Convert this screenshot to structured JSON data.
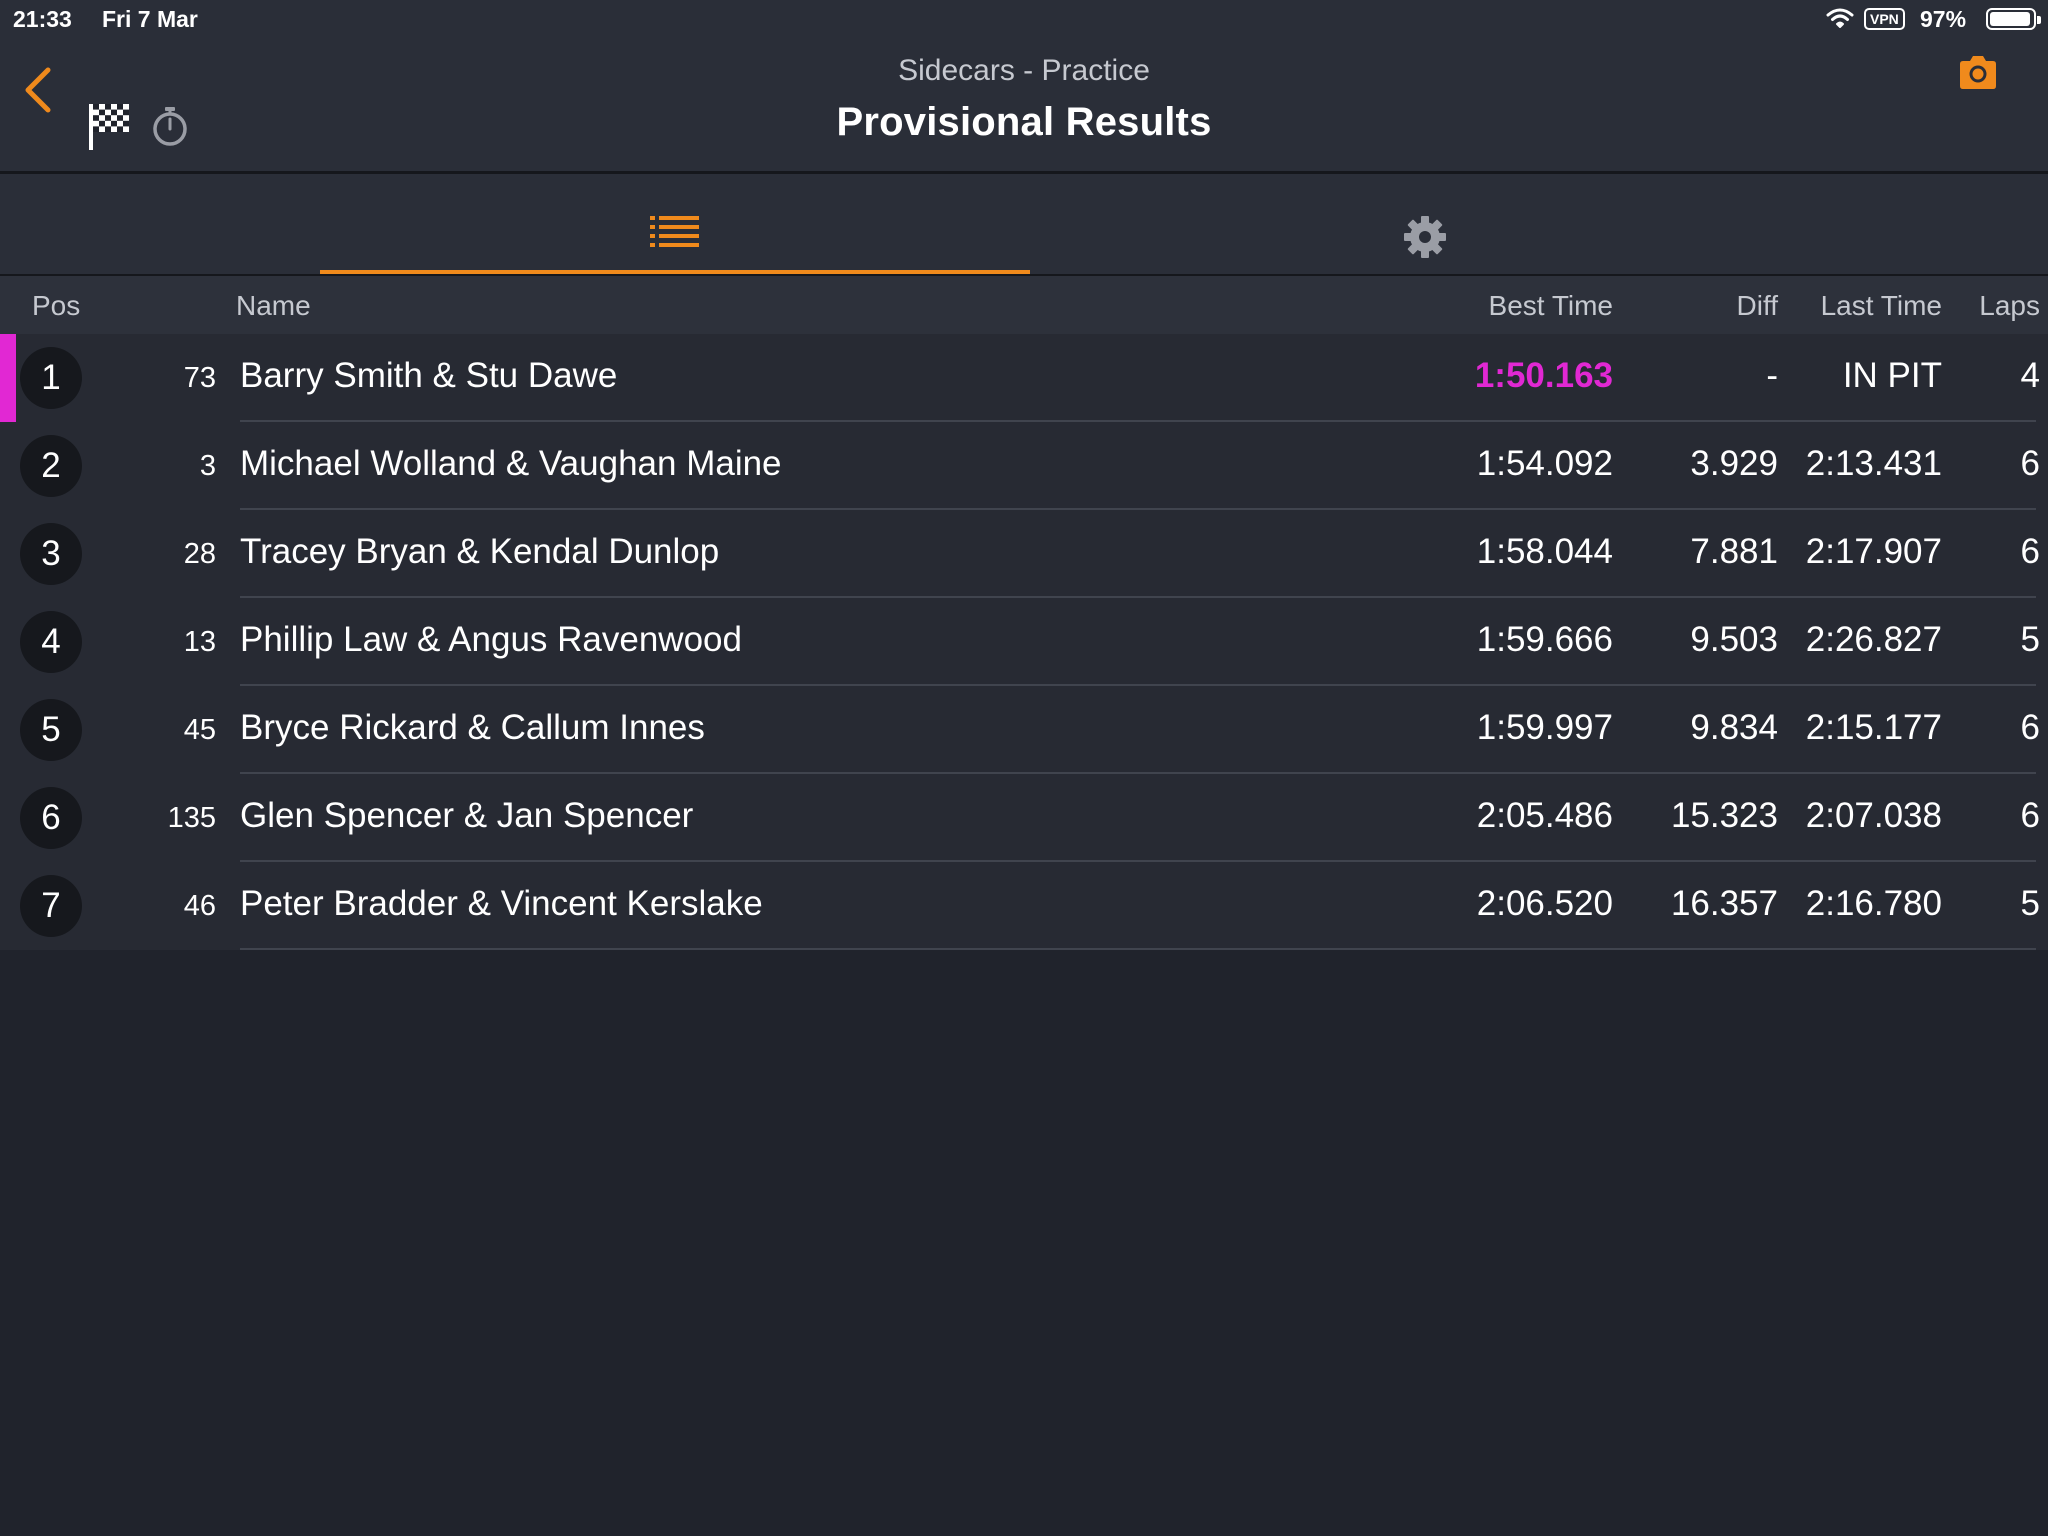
{
  "status_bar": {
    "time": "21:33",
    "date": "Fri 7 Mar",
    "vpn": "VPN",
    "battery": "97%",
    "battery_level": 0.97
  },
  "header": {
    "subtitle": "Sidecars - Practice",
    "title": "Provisional Results",
    "back_icon": "chevron-left-icon",
    "flag_icon": "checkered-flag-icon",
    "stopwatch_icon": "stopwatch-icon",
    "camera_icon": "camera-icon"
  },
  "tabs": [
    {
      "icon": "list-icon",
      "active": true
    },
    {
      "icon": "gear-icon",
      "active": false
    }
  ],
  "columns": {
    "pos": "Pos",
    "name": "Name",
    "best": "Best Time",
    "diff": "Diff",
    "last": "Last Time",
    "laps": "Laps"
  },
  "rows": [
    {
      "pos": "1",
      "num": "73",
      "name": "Barry Smith & Stu Dawe",
      "best": "1:50.163",
      "diff": "-",
      "last": "IN PIT",
      "laps": "4",
      "fastest": true
    },
    {
      "pos": "2",
      "num": "3",
      "name": "Michael Wolland & Vaughan Maine",
      "best": "1:54.092",
      "diff": "3.929",
      "last": "2:13.431",
      "laps": "6"
    },
    {
      "pos": "3",
      "num": "28",
      "name": "Tracey Bryan & Kendal Dunlop",
      "best": "1:58.044",
      "diff": "7.881",
      "last": "2:17.907",
      "laps": "6"
    },
    {
      "pos": "4",
      "num": "13",
      "name": "Phillip Law & Angus Ravenwood",
      "best": "1:59.666",
      "diff": "9.503",
      "last": "2:26.827",
      "laps": "5"
    },
    {
      "pos": "5",
      "num": "45",
      "name": "Bryce Rickard & Callum Innes",
      "best": "1:59.997",
      "diff": "9.834",
      "last": "2:15.177",
      "laps": "6"
    },
    {
      "pos": "6",
      "num": "135",
      "name": "Glen Spencer & Jan Spencer",
      "best": "2:05.486",
      "diff": "15.323",
      "last": "2:07.038",
      "laps": "6"
    },
    {
      "pos": "7",
      "num": "46",
      "name": "Peter Bradder & Vincent Kerslake",
      "best": "2:06.520",
      "diff": "16.357",
      "last": "2:16.780",
      "laps": "5"
    }
  ],
  "colors": {
    "accent": "#f08a1c",
    "fastest": "#e128d3",
    "background": "#20232c"
  }
}
